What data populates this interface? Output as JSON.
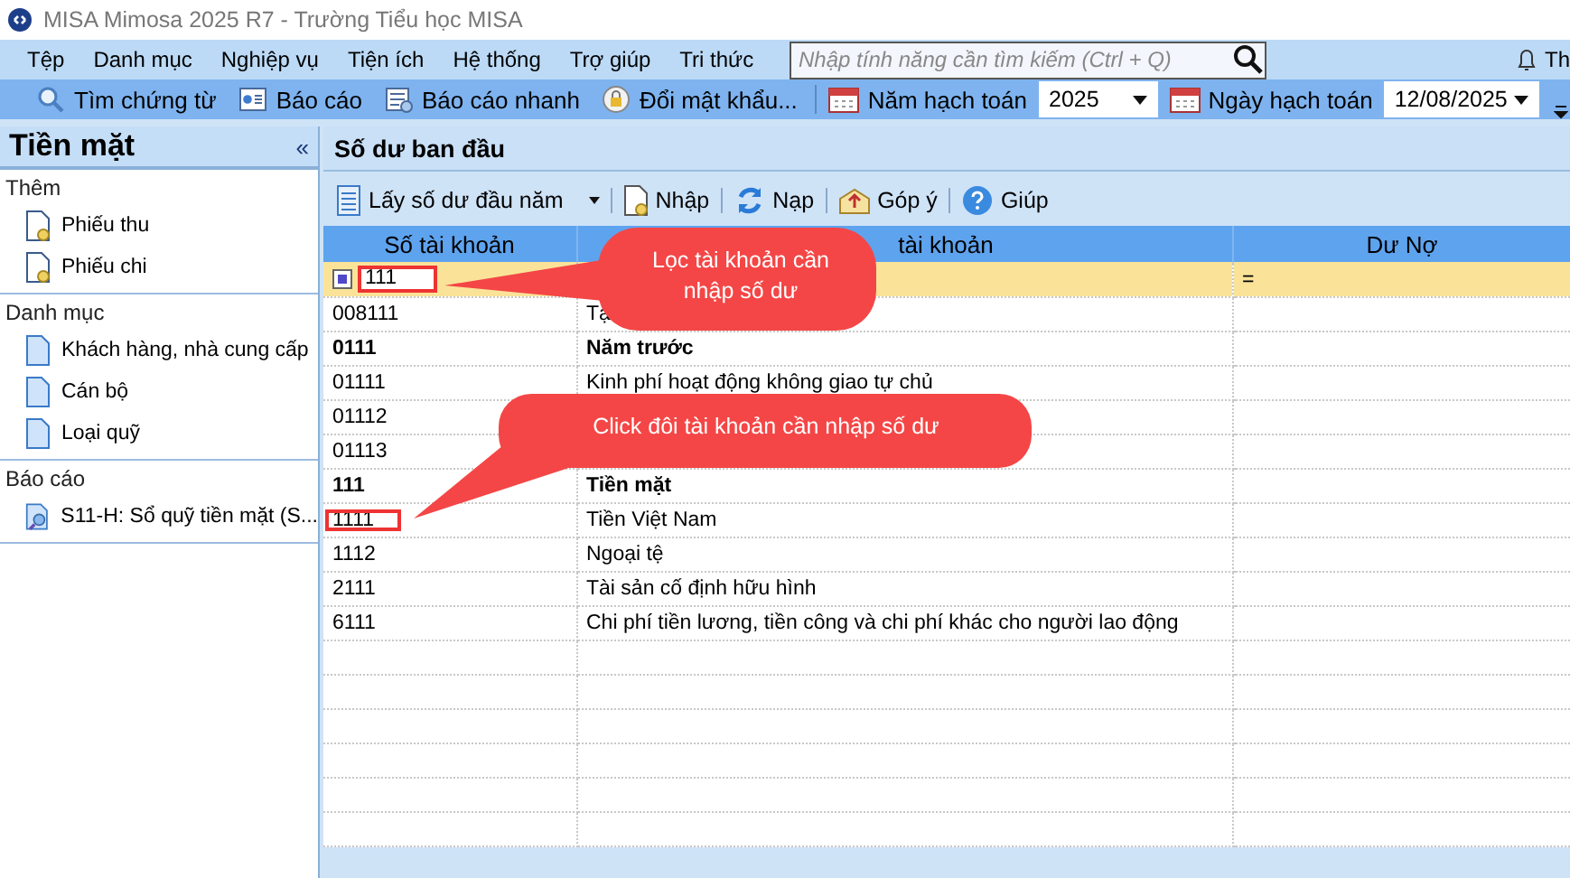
{
  "window": {
    "title": "MISA Mimosa 2025 R7 - Trường Tiểu học MISA"
  },
  "menu": [
    "Tệp",
    "Danh mục",
    "Nghiệp vụ",
    "Tiện ích",
    "Hệ thống",
    "Trợ giúp",
    "Tri thức"
  ],
  "search": {
    "placeholder": "Nhập tính năng cần tìm kiếm (Ctrl + Q)"
  },
  "notification": {
    "label": "Th"
  },
  "toolbar": {
    "buttons": [
      {
        "kind": "search",
        "label": "Tìm chứng từ"
      },
      {
        "kind": "report",
        "label": "Báo cáo"
      },
      {
        "kind": "quick",
        "label": "Báo cáo nhanh"
      },
      {
        "kind": "lock",
        "label": "Đổi mật khẩu..."
      }
    ],
    "year": {
      "label": "Năm hạch toán",
      "value": "2025"
    },
    "date": {
      "label": "Ngày hạch toán",
      "value": "12/08/2025"
    }
  },
  "sidebar": {
    "title": "Tiền mặt",
    "collapse": "«",
    "sections": [
      {
        "title": "Thêm",
        "items": [
          {
            "kind": "voucher",
            "label": "Phiếu thu"
          },
          {
            "kind": "voucher",
            "label": "Phiếu chi"
          }
        ]
      },
      {
        "title": "Danh mục",
        "items": [
          {
            "kind": "list",
            "label": "Khách hàng, nhà cung cấp"
          },
          {
            "kind": "list",
            "label": "Cán bộ"
          },
          {
            "kind": "list",
            "label": "Loại quỹ"
          }
        ]
      },
      {
        "title": "Báo cáo",
        "items": [
          {
            "kind": "report",
            "label": "S11-H: Sổ quỹ tiền mặt (S..."
          }
        ]
      }
    ]
  },
  "main": {
    "title": "Số dư ban đầu",
    "toolbar": [
      {
        "kind": "get",
        "label": "Lấy số dư đầu năm",
        "dropdown": true
      },
      {
        "kind": "import",
        "label": "Nhập",
        "dropdown": false
      },
      {
        "kind": "reload",
        "label": "Nạp",
        "dropdown": false
      },
      {
        "kind": "feedback",
        "label": "Góp ý",
        "dropdown": false
      },
      {
        "kind": "help",
        "label": "Giúp",
        "dropdown": false
      }
    ],
    "table": {
      "columns": [
        "Số tài khoản",
        "tài khoản",
        "Dư Nợ"
      ],
      "filter": {
        "value": "111",
        "operator": "="
      },
      "rows": [
        {
          "account": "008111",
          "name": "Tạ",
          "bold": false
        },
        {
          "account": "0111",
          "name": "Năm trước",
          "bold": true
        },
        {
          "account": "01111",
          "name": "Kinh phí hoạt động không giao tự chủ",
          "bold": false
        },
        {
          "account": "01112",
          "bold": false
        },
        {
          "account": "01113",
          "bold": false
        },
        {
          "account": "111",
          "name": "Tiền mặt",
          "bold": true
        },
        {
          "account": "1111",
          "name": "Tiền Việt Nam",
          "bold": false
        },
        {
          "account": "1112",
          "name": "Ngoại tệ",
          "bold": false
        },
        {
          "account": "2111",
          "name": "Tài sản cố định hữu hình",
          "bold": false
        },
        {
          "account": "6111",
          "name": "Chi phí tiền lương, tiền công và chi phí khác cho người lao động",
          "bold": false
        }
      ]
    },
    "callouts": [
      "Lọc tài khoản cần nhập số dư",
      "Click đôi tài khoản cần nhập số dư"
    ]
  }
}
